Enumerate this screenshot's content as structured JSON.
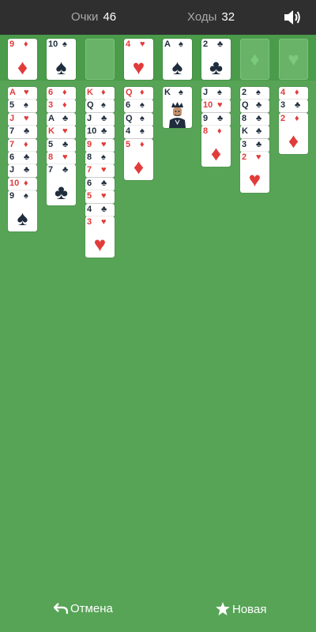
{
  "header": {
    "score_label": "Очки",
    "score_value": "46",
    "moves_label": "Ходы",
    "moves_value": "32",
    "sound_icon": "speaker-icon"
  },
  "top_row": {
    "freecells": [
      {
        "rank": "9",
        "suit": "♦",
        "color": "red"
      },
      {
        "rank": "10",
        "suit": "♠",
        "color": "black"
      },
      {
        "empty": true
      }
    ],
    "foundations": [
      {
        "rank": "4",
        "suit": "♥",
        "color": "red"
      },
      {
        "rank": "A",
        "suit": "♠",
        "color": "black"
      },
      {
        "rank": "2",
        "suit": "♣",
        "color": "black"
      },
      {
        "empty": true,
        "suit": "♦"
      },
      {
        "empty": true,
        "suit": "♥"
      }
    ]
  },
  "tableau": [
    [
      [
        "A",
        "♥",
        "red"
      ],
      [
        "5",
        "♠",
        "black"
      ],
      [
        "J",
        "♥",
        "red"
      ],
      [
        "7",
        "♣",
        "black"
      ],
      [
        "7",
        "♦",
        "red"
      ],
      [
        "6",
        "♣",
        "black"
      ],
      [
        "J",
        "♣",
        "black"
      ],
      [
        "10",
        "♦",
        "red"
      ],
      [
        "9",
        "♠",
        "black"
      ]
    ],
    [
      [
        "6",
        "♦",
        "red"
      ],
      [
        "3",
        "♦",
        "red"
      ],
      [
        "A",
        "♣",
        "black"
      ],
      [
        "K",
        "♥",
        "red"
      ],
      [
        "5",
        "♣",
        "black"
      ],
      [
        "8",
        "♥",
        "red"
      ],
      [
        "7",
        "♣",
        "black"
      ]
    ],
    [
      [
        "K",
        "♦",
        "red"
      ],
      [
        "Q",
        "♠",
        "black"
      ],
      [
        "J",
        "♣",
        "black"
      ],
      [
        "10",
        "♣",
        "black"
      ],
      [
        "9",
        "♥",
        "red"
      ],
      [
        "8",
        "♠",
        "black"
      ],
      [
        "7",
        "♥",
        "red"
      ],
      [
        "6",
        "♣",
        "black"
      ],
      [
        "5",
        "♥",
        "red"
      ],
      [
        "4",
        "♣",
        "black"
      ],
      [
        "3",
        "♥",
        "red"
      ]
    ],
    [
      [
        "Q",
        "♦",
        "red"
      ],
      [
        "6",
        "♠",
        "black"
      ],
      [
        "Q",
        "♠",
        "black"
      ],
      [
        "4",
        "♠",
        "black"
      ],
      [
        "5",
        "♦",
        "red"
      ]
    ],
    [
      [
        "K",
        "♠",
        "black"
      ]
    ],
    [
      [
        "J",
        "♠",
        "black"
      ],
      [
        "10",
        "♥",
        "red"
      ],
      [
        "9",
        "♣",
        "black"
      ],
      [
        "8",
        "♦",
        "red"
      ]
    ],
    [
      [
        "2",
        "♠",
        "black"
      ],
      [
        "Q",
        "♣",
        "black"
      ],
      [
        "8",
        "♣",
        "black"
      ],
      [
        "K",
        "♣",
        "black"
      ],
      [
        "3",
        "♣",
        "black"
      ],
      [
        "2",
        "♥",
        "red"
      ]
    ],
    [
      [
        "4",
        "♦",
        "red"
      ],
      [
        "3",
        "♣",
        "black"
      ],
      [
        "2",
        "♦",
        "red"
      ]
    ]
  ],
  "footer": {
    "undo_label": "Отмена",
    "new_label": "Новая"
  }
}
